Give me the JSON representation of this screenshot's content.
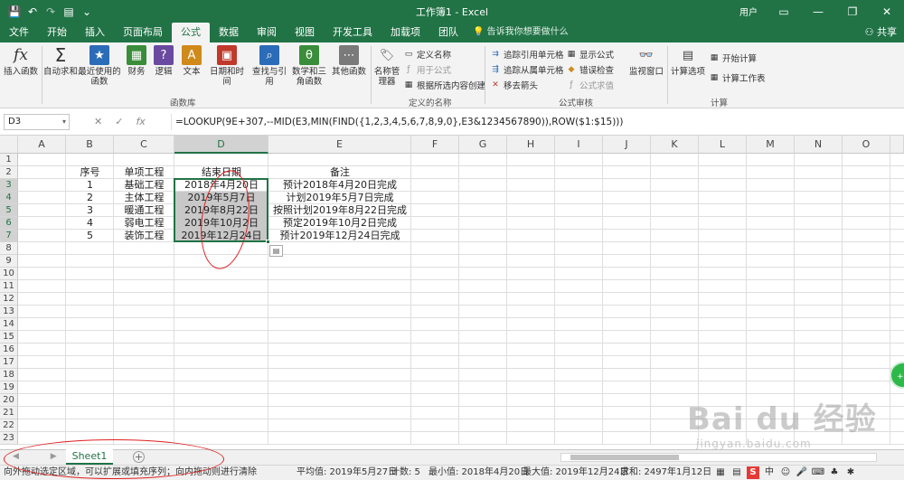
{
  "window": {
    "title": "工作簿1  -  Excel",
    "user": "用户",
    "share_label": "共享"
  },
  "ribbon_tabs": [
    "文件",
    "开始",
    "插入",
    "页面布局",
    "公式",
    "数据",
    "审阅",
    "视图",
    "开发工具",
    "加载项",
    "团队"
  ],
  "active_tab": "公式",
  "tell_me": "告诉我你想要做什么",
  "ribbon": {
    "insert_function": "插入函数",
    "autosum": "自动求和",
    "recent": "最近使用的函数",
    "financial": "财务",
    "logical": "逻辑",
    "text": "文本",
    "datetime": "日期和时间",
    "lookup": "查找与引用",
    "math": "数学和三角函数",
    "other": "其他函数",
    "group_library": "函数库",
    "name_manager": "名称管理器",
    "define_name": "定义名称",
    "use_in_formula": "用于公式",
    "create_from_selection": "根据所选内容创建",
    "group_names": "定义的名称",
    "trace_precedents": "追踪引用单元格",
    "trace_dependents": "追踪从属单元格",
    "remove_arrows": "移去箭头",
    "show_formulas": "显示公式",
    "error_checking": "错误检查",
    "evaluate_formula": "公式求值",
    "group_auditing": "公式审核",
    "watch_window": "监视窗口",
    "calc_options": "计算选项",
    "calc_now": "开始计算",
    "calc_sheet": "计算工作表",
    "group_calc": "计算"
  },
  "formula_bar": {
    "name_box": "D3",
    "cancel": "✕",
    "enter": "✓",
    "fx": "fx",
    "formula": "=LOOKUP(9E+307,--MID(E3,MIN(FIND({1,2,3,4,5,6,7,8,9,0},E3&1234567890)),ROW($1:$15)))"
  },
  "columns": [
    "A",
    "B",
    "C",
    "D",
    "E",
    "F",
    "G",
    "H",
    "I",
    "J",
    "K",
    "L",
    "M",
    "N",
    "O"
  ],
  "rows": [
    "1",
    "2",
    "3",
    "4",
    "5",
    "6",
    "7",
    "8",
    "9",
    "10",
    "11",
    "12",
    "13",
    "14",
    "15",
    "16",
    "17",
    "18",
    "19",
    "20",
    "21",
    "22",
    "23"
  ],
  "table": {
    "headers": [
      "序号",
      "单项工程",
      "结束日期",
      "备注"
    ],
    "rows": [
      [
        "1",
        "基础工程",
        "2018年4月20日",
        "预计2018年4月20日完成"
      ],
      [
        "2",
        "主体工程",
        "2019年5月7日",
        "计划2019年5月7日完成"
      ],
      [
        "3",
        "暖通工程",
        "2019年8月22日",
        "按照计划2019年8月22日完成"
      ],
      [
        "4",
        "弱电工程",
        "2019年10月2日",
        "预定2019年10月2日完成"
      ],
      [
        "5",
        "装饰工程",
        "2019年12月24日",
        "预计2019年12月24日完成"
      ]
    ]
  },
  "sheet": {
    "name": "Sheet1",
    "nav": "◀ ▶",
    "add": "+"
  },
  "status": {
    "message": "向外拖动选定区域，可以扩展或填充序列；向内拖动则进行清除",
    "average": "平均值: 2019年5月27日",
    "count": "计数: 5",
    "min": "最小值: 2018年4月20日",
    "max": "最大值: 2019年12月24日",
    "sum": "求和: 2497年1月12日"
  },
  "badge_text": "+5",
  "watermark": {
    "main": "Bai du 经验",
    "sub": "jingyan.baidu.com"
  }
}
